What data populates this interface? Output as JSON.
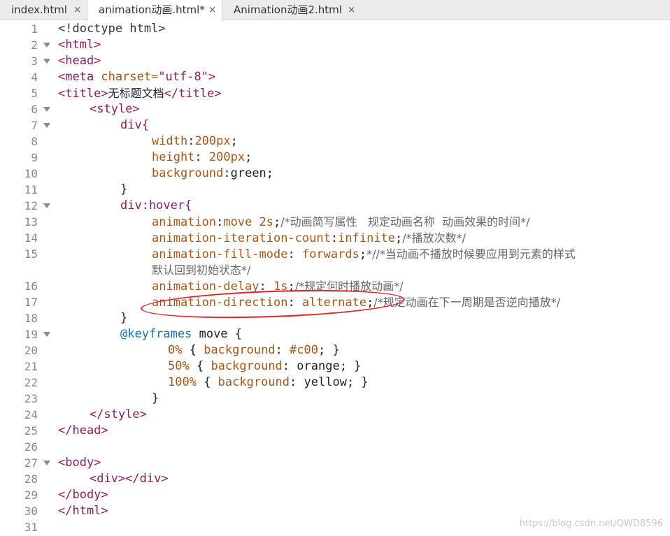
{
  "tabs": [
    {
      "label": "index.html",
      "close": "×"
    },
    {
      "label": "animation动画.html*",
      "close": "×"
    },
    {
      "label": "Animation动画2.html",
      "close": "×"
    }
  ],
  "watermark": "https://blog.csdn.net/QWD8596",
  "annotation_color": "#e3212b",
  "code": {
    "l1": {
      "num": "1",
      "t": "<!doctype html>"
    },
    "l2": {
      "num": "2",
      "a": "<html>"
    },
    "l3": {
      "num": "3",
      "a": "<head>"
    },
    "l4": {
      "num": "4",
      "a": "<meta ",
      "b": "charset=",
      "c": "\"utf-8\"",
      "d": ">"
    },
    "l5": {
      "num": "5",
      "a": "<title>",
      "b": "无标题文档",
      "c": "</title>"
    },
    "l6": {
      "num": "6",
      "a": "<style>"
    },
    "l7": {
      "num": "7",
      "a": "div{"
    },
    "l8": {
      "num": "8",
      "a": "width",
      "b": ":",
      "c": "200px",
      "d": ";"
    },
    "l9": {
      "num": "9",
      "a": "height",
      "b": ": ",
      "c": "200px",
      "d": ";"
    },
    "l10": {
      "num": "10",
      "a": "background",
      "b": ":",
      "c": "green",
      "d": ";"
    },
    "l11": {
      "num": "11",
      "a": "}"
    },
    "l12": {
      "num": "12",
      "a": "div:hover{"
    },
    "l13": {
      "num": "13",
      "a": "animation",
      "b": ":",
      "c": "move 2s",
      "d": ";",
      "e": "/*动画简写属性   规定动画名称  动画效果的时间*/"
    },
    "l14": {
      "num": "14",
      "a": "animation-iteration-count",
      "b": ":",
      "c": "infinite",
      "d": ";",
      "e": "/*播放次数*/"
    },
    "l15": {
      "num": "15",
      "a": "animation-fill-mode",
      "b": ": ",
      "c": "forwards",
      "d": ";",
      "e": "*//*当动画不播放时候要应用到元素的样式",
      "f": "默认回到初始状态*/"
    },
    "l16": {
      "num": "16",
      "a": "animation-delay",
      "b": ": ",
      "c": "1s",
      "d": ";",
      "e": "/*规定何时播放动画*/"
    },
    "l17": {
      "num": "17",
      "a": "animation-direction",
      "b": ": ",
      "c": "alternate",
      "d": ";",
      "e": "/*规定动画在下一周期是否逆向播放*/"
    },
    "l18": {
      "num": "18",
      "a": "}"
    },
    "l19": {
      "num": "19",
      "a": "@keyframes",
      "b": " move {"
    },
    "l20": {
      "num": "20",
      "a": "0%",
      "b": " { ",
      "c": "background",
      "d": ": ",
      "e": "#c00",
      "f": "; }"
    },
    "l21": {
      "num": "21",
      "a": "50%",
      "b": " { ",
      "c": "background",
      "d": ": ",
      "e": "orange",
      "f": "; }"
    },
    "l22": {
      "num": "22",
      "a": "100%",
      "b": " { ",
      "c": "background",
      "d": ": ",
      "e": "yellow",
      "f": "; }"
    },
    "l23": {
      "num": "23",
      "a": "}"
    },
    "l24": {
      "num": "24",
      "a": "</style>"
    },
    "l25": {
      "num": "25",
      "a": "</head>"
    },
    "l26": {
      "num": "26"
    },
    "l27": {
      "num": "27",
      "a": "<body>"
    },
    "l28": {
      "num": "28",
      "a": "<div></div>"
    },
    "l29": {
      "num": "29",
      "a": "</body>"
    },
    "l30": {
      "num": "30",
      "a": "</html>"
    },
    "l31": {
      "num": "31"
    }
  }
}
